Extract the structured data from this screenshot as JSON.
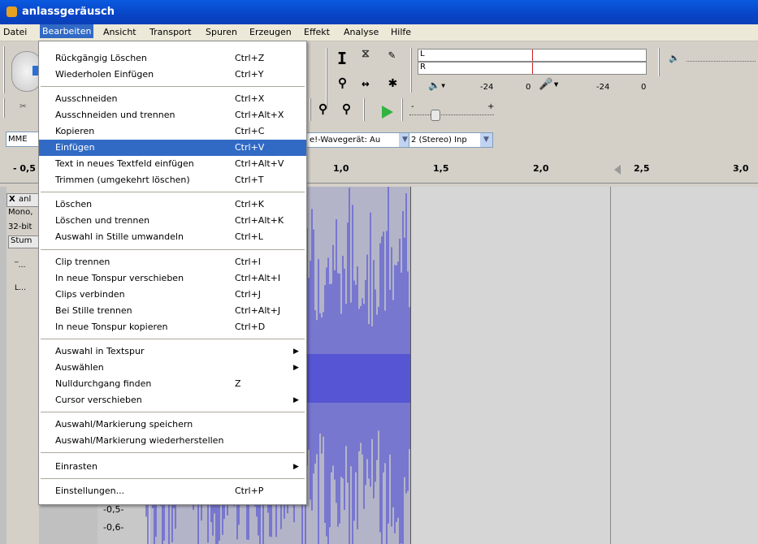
{
  "window": {
    "title": "anlassgeräusch"
  },
  "menubar": [
    "Datei",
    "Bearbeiten",
    "Ansicht",
    "Transport",
    "Spuren",
    "Erzeugen",
    "Effekt",
    "Analyse",
    "Hilfe"
  ],
  "menubar_active": "Bearbeiten",
  "toolbar": {
    "meter_l": "L",
    "meter_r": "R",
    "db_left": "-24",
    "zero_left": "0",
    "db_right": "-24",
    "zero_right": "0",
    "slider_plus": "+",
    "slider_minus": "-",
    "host_combo": "MME",
    "device_combo": "e!-Wavegerät: Au",
    "channels_combo": "2 (Stereo) Inp"
  },
  "ruler": {
    "ticks": [
      "- 0,5",
      "1,0",
      "1,5",
      "2,0",
      "2,5",
      "3,0"
    ]
  },
  "track": {
    "close": "X",
    "name": "anl",
    "info1": "Mono,",
    "info2": "32-bit",
    "mute": "Stum",
    "scale_a": "-0,5-",
    "scale_b": "-0,6-"
  },
  "edit_menu": [
    {
      "label": "Rückgängig Löschen",
      "shortcut": "Ctrl+Z"
    },
    {
      "label": "Wiederholen Einfügen",
      "shortcut": "Ctrl+Y"
    },
    {
      "label": "Ausschneiden",
      "shortcut": "Ctrl+X"
    },
    {
      "label": "Ausschneiden und trennen",
      "shortcut": "Ctrl+Alt+X"
    },
    {
      "label": "Kopieren",
      "shortcut": "Ctrl+C"
    },
    {
      "label": "Einfügen",
      "shortcut": "Ctrl+V"
    },
    {
      "label": "Text in neues Textfeld einfügen",
      "shortcut": "Ctrl+Alt+V"
    },
    {
      "label": "Trimmen (umgekehrt löschen)",
      "shortcut": "Ctrl+T"
    },
    {
      "label": "Löschen",
      "shortcut": "Ctrl+K"
    },
    {
      "label": "Löschen und trennen",
      "shortcut": "Ctrl+Alt+K"
    },
    {
      "label": "Auswahl in Stille umwandeln",
      "shortcut": "Ctrl+L"
    },
    {
      "label": "Clip trennen",
      "shortcut": "Ctrl+I"
    },
    {
      "label": "In neue Tonspur verschieben",
      "shortcut": "Ctrl+Alt+I"
    },
    {
      "label": "Clips verbinden",
      "shortcut": "Ctrl+J"
    },
    {
      "label": "Bei Stille trennen",
      "shortcut": "Ctrl+Alt+J"
    },
    {
      "label": "In neue Tonspur kopieren",
      "shortcut": "Ctrl+D"
    },
    {
      "label": "Auswahl in Textspur",
      "shortcut": ""
    },
    {
      "label": "Auswählen",
      "shortcut": ""
    },
    {
      "label": "Nulldurchgang finden",
      "shortcut": "Z"
    },
    {
      "label": "Cursor verschieben",
      "shortcut": ""
    },
    {
      "label": "Auswahl/Markierung speichern",
      "shortcut": ""
    },
    {
      "label": "Auswahl/Markierung wiederherstellen",
      "shortcut": ""
    },
    {
      "label": "Einrasten",
      "shortcut": ""
    },
    {
      "label": "Einstellungen...",
      "shortcut": "Ctrl+P"
    }
  ],
  "highlighted_item": "Einfügen",
  "colors": {
    "selection_blue": "#316ac5",
    "waveform": "#3a3ad8",
    "titlebar": "#0a5ae0"
  }
}
